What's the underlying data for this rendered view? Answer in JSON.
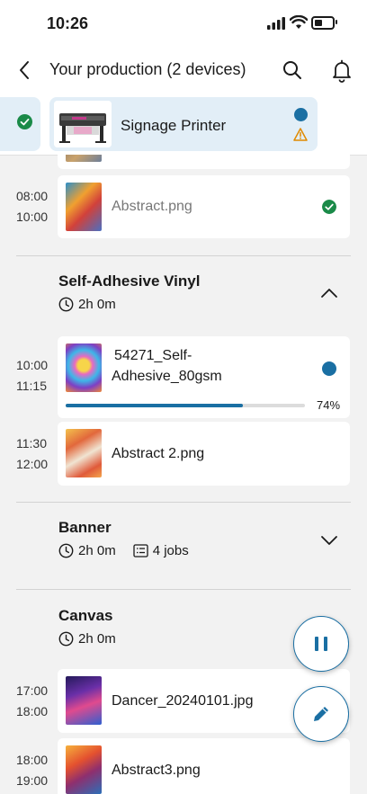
{
  "status_bar": {
    "time": "10:26"
  },
  "header": {
    "title": "Your production (2 devices)"
  },
  "devices": {
    "selected_name": "Signage Printer"
  },
  "jobs": {
    "abstract": {
      "start": "08:00",
      "end": "10:00",
      "name": "Abstract.png"
    },
    "vinyl_job1": {
      "start": "10:00",
      "end": "11:15",
      "name_line1": "54271_Self-",
      "name_line2": "Adhesive_80gsm",
      "progress_label": "74%",
      "progress": 0.74
    },
    "vinyl_job2": {
      "start": "11:30",
      "end": "12:00",
      "name": "Abstract 2.png"
    },
    "dancer": {
      "start": "17:00",
      "end": "18:00",
      "name": "Dancer_20240101.jpg"
    },
    "abstract3": {
      "start": "18:00",
      "end": "19:00",
      "name": "Abstract3.png"
    }
  },
  "groups": {
    "vinyl": {
      "title": "Self-Adhesive Vinyl",
      "duration": "2h 0m"
    },
    "banner": {
      "title": "Banner",
      "duration": "2h 0m",
      "jobs": "4 jobs"
    },
    "canvas": {
      "title": "Canvas",
      "duration": "2h 0m"
    }
  },
  "colors": {
    "accent": "#1a6fa3",
    "success": "#1a8a48",
    "warning": "#e08a00"
  },
  "icons": [
    "back-arrow-icon",
    "search-icon",
    "bell-icon",
    "check-circle-icon",
    "warning-icon",
    "clock-icon",
    "list-icon",
    "chevron-up-icon",
    "chevron-down-icon",
    "pause-icon",
    "pencil-icon"
  ]
}
